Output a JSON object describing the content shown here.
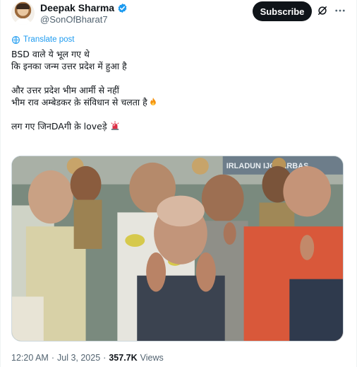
{
  "author": {
    "name": "Deepak Sharma",
    "handle": "@SonOfBharat7",
    "verified": true
  },
  "actions": {
    "subscribe_label": "Subscribe"
  },
  "icons": {
    "verified": "verified-badge-icon",
    "grok": "grok-icon",
    "more": "more-options-icon",
    "translate": "translate-icon",
    "fire": "fire-emoji",
    "siren": "siren-emoji"
  },
  "translate_label": "Translate post",
  "post": {
    "lines": [
      "BSD वाले ये भूल गए थे",
      "कि इनका जन्म उत्तर प्रदेश में हुआ है",
      "और उत्तर प्रदेश भीम आर्मी से नहीं",
      "भीम राव अम्बेडकर क़े संविधान से चलता है",
      "लग गए जिनDAगी क़े loveड़े"
    ]
  },
  "media": {
    "banner_text": "IRLADUN IJOHARBAS"
  },
  "meta": {
    "time": "12:20 AM",
    "date": "Jul 3, 2025",
    "views_count": "357.7K",
    "views_label": "Views"
  },
  "colors": {
    "accent": "#1d9bf0",
    "text_primary": "#0f1419",
    "text_secondary": "#536471",
    "button_bg": "#0f1419",
    "border": "#cfd9de"
  }
}
